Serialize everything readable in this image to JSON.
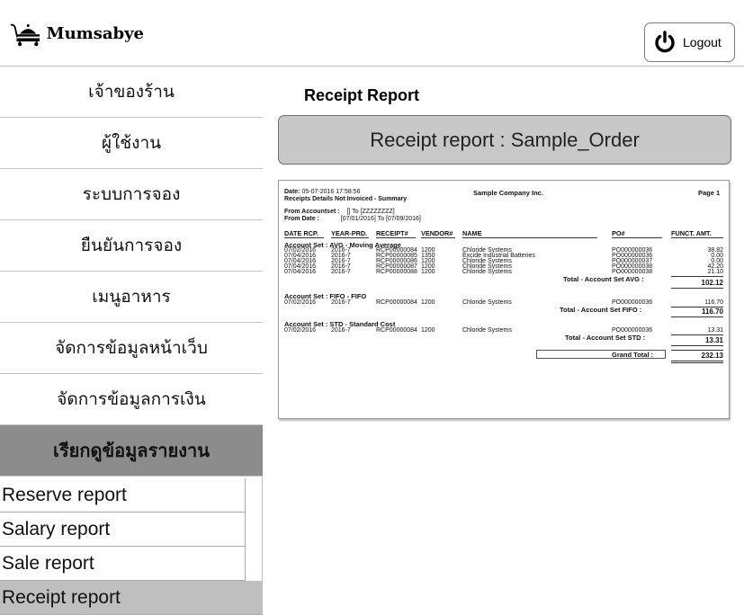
{
  "app": {
    "logo_text": "Mumsabye",
    "logout_label": "Logout"
  },
  "sidebar": {
    "items": [
      {
        "label": "เจ้าของร้าน"
      },
      {
        "label": "ผู้ใช้งาน"
      },
      {
        "label": "ระบบการจอง"
      },
      {
        "label": "ยืนยันการจอง"
      },
      {
        "label": "เมนูอาหาร"
      },
      {
        "label": "จัดการข้อมูลหน้าเว็บ"
      },
      {
        "label": "จัดการข้อมูลการเงิน"
      },
      {
        "label": "เรียกดูข้อมูลรายงาน"
      }
    ],
    "sub_items": [
      {
        "label": "Reserve report"
      },
      {
        "label": "Salary report"
      },
      {
        "label": "Sale report"
      },
      {
        "label": "Receipt report"
      }
    ]
  },
  "main": {
    "page_title": "Receipt Report",
    "report_title": "Receipt report : Sample_Order"
  },
  "report": {
    "date_label": "Date:",
    "date_value": "05-07-2016 17:58:56",
    "subtitle": "Receipts Details Not Invoiced - Summary",
    "company": "Sample Company Inc.",
    "page": "Page 1",
    "from_accountset_label": "From Accountset :",
    "from_accountset_value": "[] To [ZZZZZZZZ]",
    "from_date_label": "From Date :",
    "from_date_value": "[07/01/2016]  To [07/09/2016]",
    "columns": [
      "DATE RCP.",
      "YEAR-PRD.",
      "RECEIPT#",
      "VENDOR#",
      "NAME",
      "PO#",
      "FUNCT. AMT."
    ],
    "groups": [
      {
        "title": "Account Set : AVG - Moving Average",
        "rows": [
          [
            "07/02/2016",
            "2016-7",
            "RCP00000084",
            "1200",
            "Chloride Systems",
            "PO000000036",
            "38.82"
          ],
          [
            "07/04/2016",
            "2016-7",
            "RCP00000085",
            "1350",
            "Excide Industrial Batteries",
            "PO000000036",
            "0.00"
          ],
          [
            "07/04/2016",
            "2016-7",
            "RCP00000086",
            "1200",
            "Chloride Systems",
            "PO000000037",
            "0.00"
          ],
          [
            "07/04/2016",
            "2016-7",
            "RCP00000087",
            "1200",
            "Chloride Systems",
            "PO000000038",
            "42.20"
          ],
          [
            "07/04/2016",
            "2016-7",
            "RCP00000088",
            "1200",
            "Chloride Systems",
            "PO000000038",
            "21.10"
          ]
        ],
        "total_label": "Total - Account Set AVG :",
        "total": "102.12"
      },
      {
        "title": "Account Set : FIFO - FIFO",
        "rows": [
          [
            "07/02/2016",
            "2016-7",
            "RCP00000084",
            "1200",
            "Chloride Systems",
            "PO000000036",
            "116.70"
          ]
        ],
        "total_label": "Total - Account Set FIFO :",
        "total": "116.70"
      },
      {
        "title": "Account Set : STD - Standard Cost",
        "rows": [
          [
            "07/02/2016",
            "2016-7",
            "RCP00000084",
            "1200",
            "Chloride Systems",
            "PO000000036",
            "13.31"
          ]
        ],
        "total_label": "Total - Account Set STD :",
        "total": "13.31"
      }
    ],
    "grand_total_label": "Grand Total :",
    "grand_total": "232.13"
  }
}
